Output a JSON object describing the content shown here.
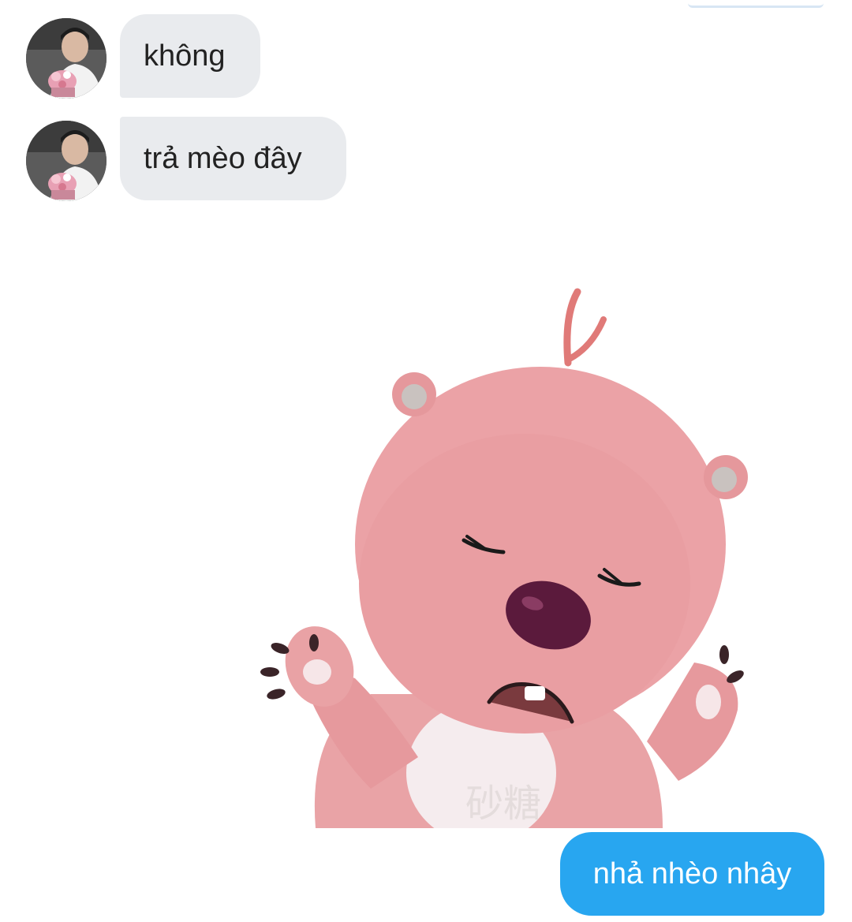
{
  "messages": [
    {
      "from": "other",
      "text": "không"
    },
    {
      "from": "other",
      "text": "trả mèo đây"
    },
    {
      "from": "other",
      "type": "sticker",
      "sticker": "pink-beaver-crying-sticker",
      "watermark": "砂糖"
    },
    {
      "from": "me",
      "text": "nhả nhèo nhây"
    }
  ],
  "colors": {
    "incoming_bubble": "#e9ebee",
    "outgoing_bubble": "#28a6f0",
    "background": "#ffffff"
  }
}
